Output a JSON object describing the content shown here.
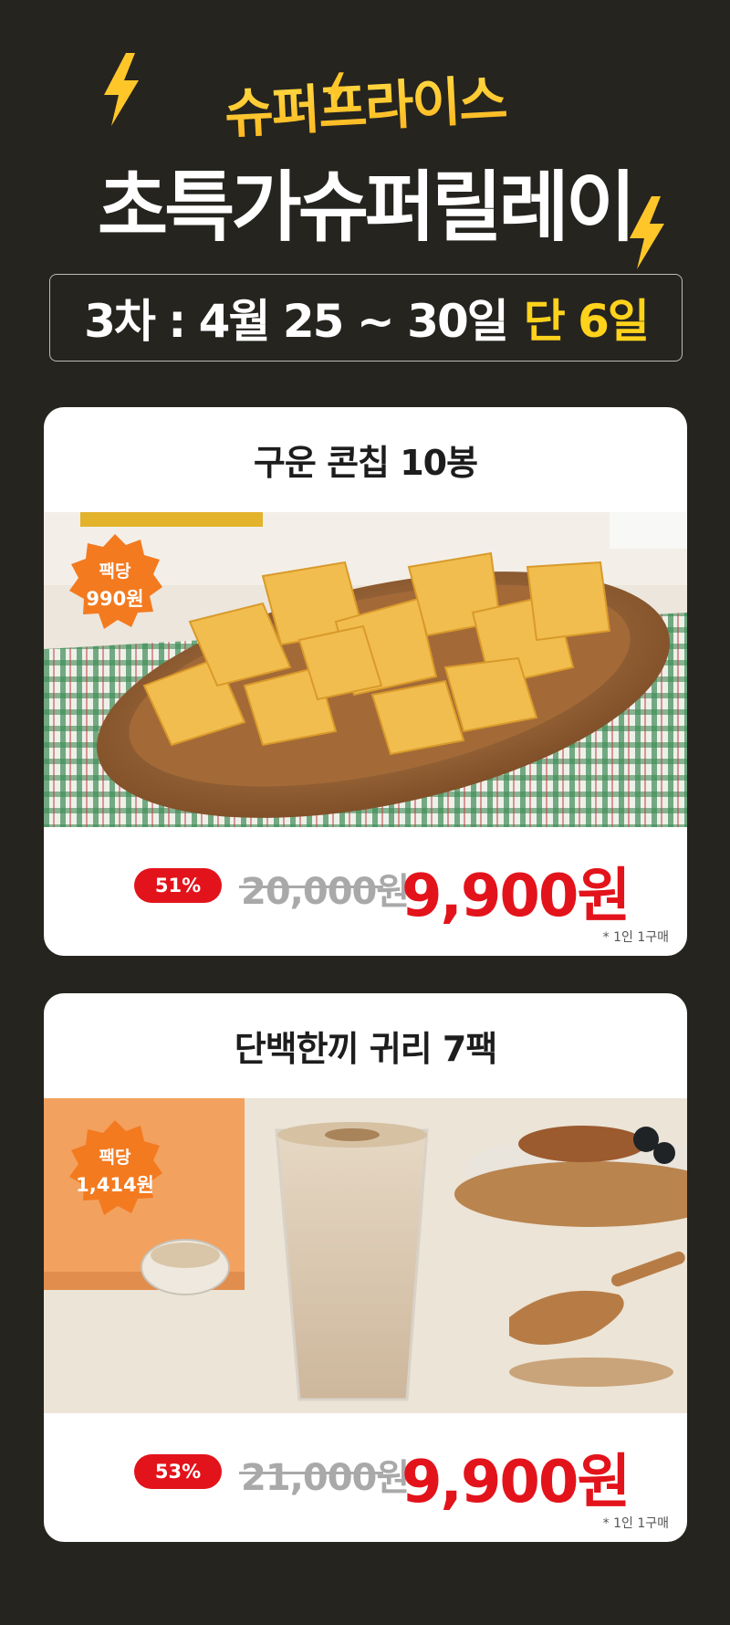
{
  "header": {
    "brand": "슈퍼프라이스",
    "headline": "초특가슈퍼릴레이",
    "date_text": "3차 : 4월 25 ~ 30일",
    "date_highlight": "단 6일"
  },
  "products": [
    {
      "title": "구운 콘칩 10봉",
      "badge_line1": "팩당",
      "badge_line2": "990원",
      "discount": "51%",
      "original_price": "20,000원",
      "sale_price": "9,900원",
      "note": "* 1인 1구매"
    },
    {
      "title": "단백한끼 귀리 7팩",
      "badge_line1": "팩당",
      "badge_line2": "1,414원",
      "discount": "53%",
      "original_price": "21,000원",
      "sale_price": "9,900원",
      "note": "* 1인 1구매"
    }
  ],
  "colors": {
    "background": "#25241f",
    "accent_yellow": "#ffd21c",
    "sale_red": "#e3131b",
    "badge_orange": "#f47a1f"
  }
}
